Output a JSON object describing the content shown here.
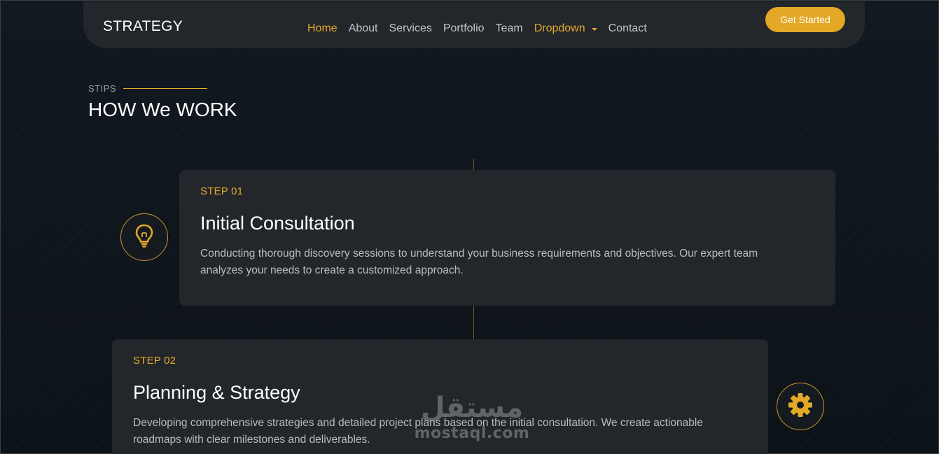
{
  "navbar": {
    "brand": "STRATEGY",
    "links": [
      "Home",
      "About",
      "Services",
      "Portfolio",
      "Team",
      "Dropdown",
      "Contact"
    ],
    "active_link": "Home",
    "highlighted_link": "Dropdown",
    "cta_label": "Get Started"
  },
  "section": {
    "kicker": "STIPS",
    "title": "HOW We WORK"
  },
  "steps": [
    {
      "label": "STEP 01",
      "title": "Initial Consultation",
      "description": "Conducting thorough discovery sessions to understand your business requirements and objectives. Our expert team analyzes your needs to create a customized approach.",
      "icon": "lightbulb-icon"
    },
    {
      "label": "STEP 02",
      "title": "Planning & Strategy",
      "description": "Developing comprehensive strategies and detailed project plans based on the initial consultation. We create actionable roadmaps with clear milestones and deliverables.",
      "icon": "gear-icon"
    }
  ],
  "watermark": {
    "arabic": "مستقل",
    "latin": "mostaql.com"
  },
  "colors": {
    "accent": "#e3a826",
    "card_bg": "#23262b",
    "page_bg": "#0f151a"
  }
}
